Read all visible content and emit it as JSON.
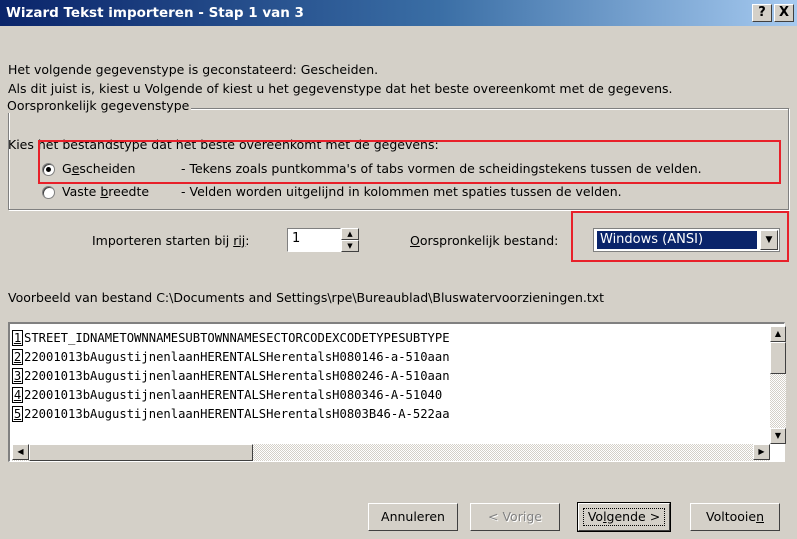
{
  "window": {
    "title": "Wizard Tekst importeren - Stap 1 van 3",
    "help_label": "?",
    "close_label": "X"
  },
  "intro": {
    "line1": "Het volgende gegevenstype is geconstateerd: Gescheiden.",
    "line2": "Als dit juist is, kiest u Volgende of kiest u het gegevenstype dat het beste overeenkomt met de gegevens."
  },
  "group": {
    "legend": "Oorspronkelijk gegevenstype",
    "prompt": "Kies het bestandstype dat het beste overeenkomt met de gegevens:",
    "options": [
      {
        "label_pre": "G",
        "label_accel": "e",
        "label_post": "scheiden",
        "description": "- Tekens zoals puntkomma's of tabs vormen de scheidingstekens tussen de velden.",
        "checked": true
      },
      {
        "label_pre": "Vaste ",
        "label_accel": "b",
        "label_post": "reedte",
        "description": "- Velden worden uitgelijnd in kolommen met spaties tussen de velden.",
        "checked": false
      }
    ]
  },
  "import_start": {
    "label_pre": "Importeren starten bij ",
    "label_accel": "rij",
    "label_post": ":",
    "value": "1"
  },
  "origin": {
    "label_pre": "",
    "label_accel": "O",
    "label_post": "orspronkelijk bestand:",
    "value": "Windows (ANSI)"
  },
  "preview": {
    "label": "Voorbeeld van bestand C:\\Documents and Settings\\rpe\\Bureaublad\\Bluswatervoorzieningen.txt",
    "rows": [
      {
        "num": "1",
        "text": "STREET_IDNAMETOWNNAMESUBTOWNNAMESECTORCODEXCODETYPESUBTYPE"
      },
      {
        "num": "2",
        "text": "22001013bAugustijnenlaanHERENTALSHerentalsH080146-a-510aan"
      },
      {
        "num": "3",
        "text": "22001013bAugustijnenlaanHERENTALSHerentalsH080246-A-510aan"
      },
      {
        "num": "4",
        "text": "22001013bAugustijnenlaanHERENTALSHerentalsH080346-A-51040"
      },
      {
        "num": "5",
        "text": "22001013bAugustijnenlaanHERENTALSHerentalsH0803B46-A-522aa"
      }
    ]
  },
  "buttons": {
    "cancel": "Annuleren",
    "back": "< Vorige",
    "next_pre": "Vo",
    "next_accel": "l",
    "next_post": "gende >",
    "finish_pre": "Voltooie",
    "finish_accel": "n",
    "finish_post": ""
  },
  "colors": {
    "highlight": "#e8202a",
    "selection": "#0a246a",
    "face": "#d4d0c8"
  }
}
